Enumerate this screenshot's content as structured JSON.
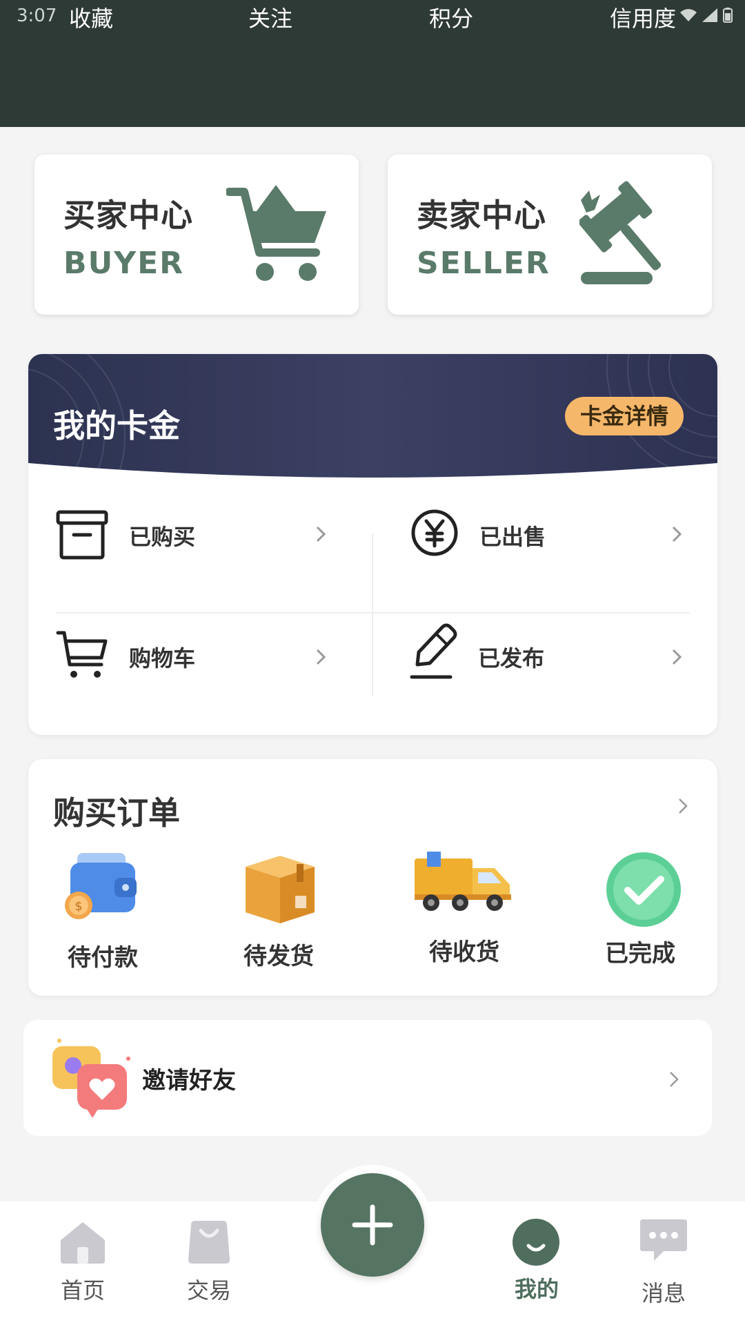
{
  "status": {
    "time": "3:07"
  },
  "header": {
    "stats": [
      {
        "label": "收藏"
      },
      {
        "label": "关注"
      },
      {
        "label": "积分"
      },
      {
        "label": "信用度"
      }
    ]
  },
  "centers": {
    "buyer": {
      "title": "买家中心",
      "sub": "BUYER",
      "icon": "cart-icon"
    },
    "seller": {
      "title": "卖家中心",
      "sub": "SELLER",
      "icon": "gavel-icon"
    }
  },
  "wallet": {
    "title": "我的卡金",
    "detail_button": "卡金详情",
    "items": [
      {
        "label": "已购买",
        "icon": "archive-box-icon"
      },
      {
        "label": "已出售",
        "icon": "yen-circle-icon"
      },
      {
        "label": "购物车",
        "icon": "shopping-cart-icon"
      },
      {
        "label": "已发布",
        "icon": "pencil-icon"
      }
    ]
  },
  "orders": {
    "title": "购买订单",
    "items": [
      {
        "label": "待付款",
        "icon": "wallet-icon"
      },
      {
        "label": "待发货",
        "icon": "package-box-icon"
      },
      {
        "label": "待收货",
        "icon": "delivery-truck-icon"
      },
      {
        "label": "已完成",
        "icon": "check-circle-icon"
      }
    ]
  },
  "invite": {
    "label": "邀请好友",
    "icon": "chat-heart-icon"
  },
  "nav": {
    "items": [
      {
        "label": "首页",
        "icon": "home-icon"
      },
      {
        "label": "交易",
        "icon": "shopping-bag-icon"
      },
      {
        "label": "我的",
        "icon": "smile-icon",
        "active": true
      },
      {
        "label": "消息",
        "icon": "message-icon"
      }
    ],
    "fab_icon": "plus-icon"
  },
  "colors": {
    "header_bg": "#2e3a35",
    "accent_green": "#557462",
    "wallet_grad_from": "#2c3250",
    "wallet_grad_to": "#474b6e",
    "detail_btn": "#f5b76a"
  }
}
